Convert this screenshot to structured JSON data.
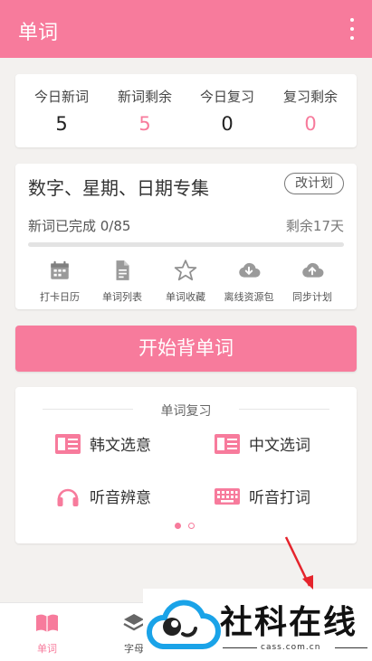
{
  "appbar": {
    "title": "单词",
    "menu_icon": "more-vertical-icon"
  },
  "stats": [
    {
      "label": "今日新词",
      "value": "5",
      "highlight": false
    },
    {
      "label": "新词剩余",
      "value": "5",
      "highlight": true
    },
    {
      "label": "今日复习",
      "value": "0",
      "highlight": false
    },
    {
      "label": "复习剩余",
      "value": "0",
      "highlight": true
    }
  ],
  "plan": {
    "title": "数字、星期、日期专集",
    "change_label": "改计划",
    "progress_label": "新词已完成 0/85",
    "progress_fraction": 0,
    "remaining_label": "剩余17天",
    "tools": [
      {
        "label": "打卡日历",
        "icon": "calendar-icon"
      },
      {
        "label": "单词列表",
        "icon": "document-icon"
      },
      {
        "label": "单词收藏",
        "icon": "star-icon"
      },
      {
        "label": "离线资源包",
        "icon": "cloud-download-icon"
      },
      {
        "label": "同步计划",
        "icon": "cloud-upload-icon"
      }
    ]
  },
  "start_button": "开始背单词",
  "review": {
    "header": "单词复习",
    "items": [
      {
        "label": "韩文选意",
        "icon": "korean-card-icon"
      },
      {
        "label": "中文选词",
        "icon": "chinese-card-icon"
      },
      {
        "label": "听音辨意",
        "icon": "headphones-icon"
      },
      {
        "label": "听音打词",
        "icon": "keyboard-icon"
      }
    ],
    "page_count": 2,
    "active_page": 1
  },
  "bottom_nav": [
    {
      "label": "单词",
      "icon": "book-icon",
      "active": true
    },
    {
      "label": "字母",
      "icon": "layers-icon",
      "active": false
    }
  ],
  "watermark": {
    "text": "社科在线",
    "url": "cass.com.cn"
  },
  "colors": {
    "accent": "#f77b9c",
    "icon_gray": "#999999",
    "background": "#f3f1ef"
  }
}
